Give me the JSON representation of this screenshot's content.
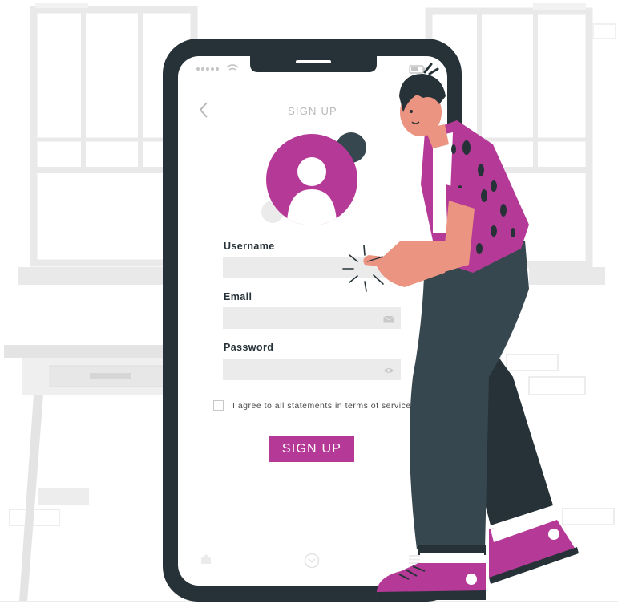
{
  "screen": {
    "title": "SIGN UP",
    "back_icon": "chevron-left-icon",
    "avatar_icon": "user-avatar-icon"
  },
  "form": {
    "username": {
      "label": "Username",
      "value": "",
      "placeholder": ""
    },
    "email": {
      "label": "Email",
      "value": "",
      "placeholder": "",
      "icon": "envelope-icon"
    },
    "password": {
      "label": "Password",
      "value": "",
      "placeholder": "",
      "icon": "eye-icon"
    },
    "agree": {
      "label": "I agree to all statements in terms of service",
      "checked": false
    },
    "submit_label": "SIGN UP"
  },
  "bottom_nav": {
    "items": [
      "home-icon",
      "chevron-circle-down-icon",
      "menu-icon"
    ]
  },
  "colors": {
    "accent": "#b53a97",
    "dark": "#263238",
    "pants": "#37474f",
    "skin": "#eb9481",
    "field": "#ebebeb",
    "wall": "#ebebeb"
  }
}
